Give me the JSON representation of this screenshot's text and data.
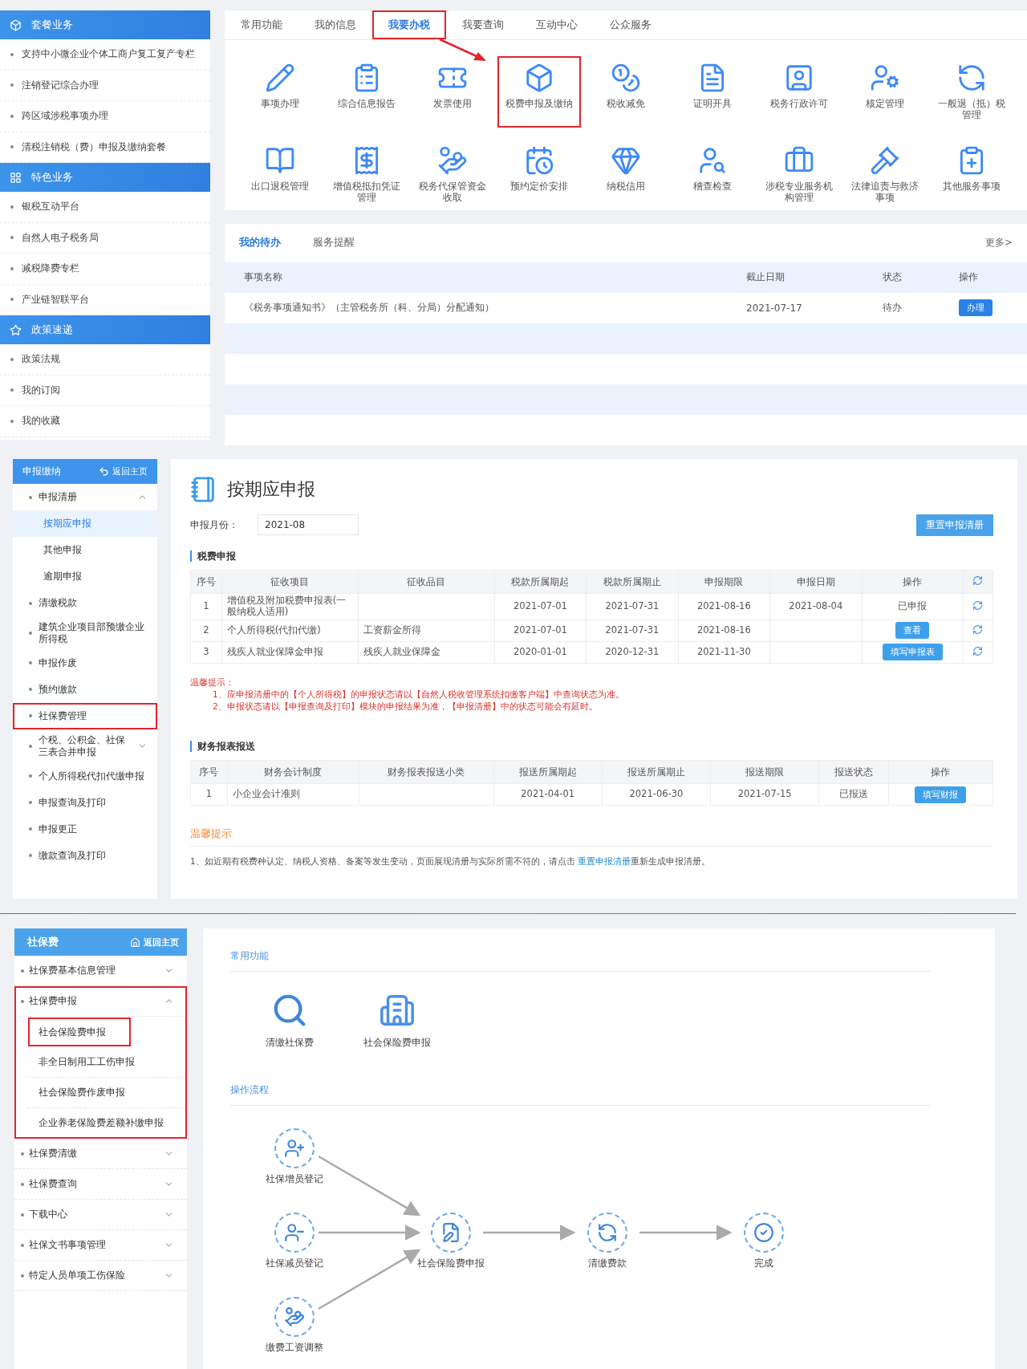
{
  "home": {
    "sidebar": [
      {
        "title": "套餐业务",
        "items": [
          {
            "label": "支持中小微企业个体工商户复工复产专栏"
          },
          {
            "label": "注销登记综合办理"
          },
          {
            "label": "跨区域涉税事项办理"
          },
          {
            "label": "清税注销税（费）申报及缴纳套餐"
          }
        ]
      },
      {
        "title": "特色业务",
        "items": [
          {
            "label": "银税互动平台"
          },
          {
            "label": "自然人电子税务局"
          },
          {
            "label": "减税降费专栏"
          },
          {
            "label": "产业链智联平台"
          }
        ]
      },
      {
        "title": "政策速递",
        "items": [
          {
            "label": "政策法规"
          },
          {
            "label": "我的订阅"
          },
          {
            "label": "我的收藏"
          }
        ]
      }
    ],
    "tabs": [
      {
        "label": "常用功能",
        "selected": false,
        "highlighted": false
      },
      {
        "label": "我的信息",
        "selected": false,
        "highlighted": false
      },
      {
        "label": "我要办税",
        "selected": true,
        "highlighted": true
      },
      {
        "label": "我要查询",
        "selected": false,
        "highlighted": false
      },
      {
        "label": "互动中心",
        "selected": false,
        "highlighted": false
      },
      {
        "label": "公众服务",
        "selected": false,
        "highlighted": false
      }
    ],
    "services": [
      {
        "label": "事项办理",
        "highlighted": false
      },
      {
        "label": "综合信息报告",
        "highlighted": false
      },
      {
        "label": "发票使用",
        "highlighted": false
      },
      {
        "label": "税费申报及缴纳",
        "highlighted": true
      },
      {
        "label": "税收减免",
        "highlighted": false
      },
      {
        "label": "证明开具",
        "highlighted": false
      },
      {
        "label": "税务行政许可",
        "highlighted": false
      },
      {
        "label": "核定管理",
        "highlighted": false
      },
      {
        "label": "一般退（抵）税管理",
        "highlighted": false
      },
      {
        "label": "出口退税管理",
        "highlighted": false
      },
      {
        "label": "增值税抵扣凭证管理",
        "highlighted": false
      },
      {
        "label": "税务代保管资金收取",
        "highlighted": false
      },
      {
        "label": "预约定价安排",
        "highlighted": false
      },
      {
        "label": "纳税信用",
        "highlighted": false
      },
      {
        "label": "稽查检查",
        "highlighted": false
      },
      {
        "label": "涉税专业服务机构管理",
        "highlighted": false
      },
      {
        "label": "法律追责与救济事项",
        "highlighted": false
      },
      {
        "label": "其他服务事项",
        "highlighted": false
      }
    ],
    "todo": {
      "tabs": [
        {
          "label": "我的待办",
          "selected": true
        },
        {
          "label": "服务提醒",
          "selected": false
        }
      ],
      "more": "更多>",
      "columns": [
        "事项名称",
        "截止日期",
        "状态",
        "操作"
      ],
      "rows": [
        {
          "name": "《税务事项通知书》（主管税务所（科、分局）分配通知）",
          "deadline": "2021-07-17",
          "status": "待办",
          "action": "办理"
        }
      ]
    }
  },
  "declaration": {
    "sidebar": {
      "title": "申报缴纳",
      "back": "返回主页",
      "items": [
        {
          "label": "申报清册",
          "expanded": true,
          "highlighted": false,
          "children": [
            {
              "label": "按期应申报",
              "selected": true
            },
            {
              "label": "其他申报",
              "selected": false
            },
            {
              "label": "逾期申报",
              "selected": false
            }
          ]
        },
        {
          "label": "清缴税款",
          "highlighted": false
        },
        {
          "label": "建筑企业项目部预缴企业所得税",
          "highlighted": false
        },
        {
          "label": "申报作废",
          "highlighted": false
        },
        {
          "label": "预约缴款",
          "highlighted": false
        },
        {
          "label": "社保费管理",
          "highlighted": true
        },
        {
          "label": "个税、公积金、社保三表合并申报",
          "expanded": false,
          "highlighted": false
        },
        {
          "label": "个人所得税代扣代缴申报",
          "highlighted": false
        },
        {
          "label": "申报查询及打印",
          "highlighted": false
        },
        {
          "label": "申报更正",
          "highlighted": false
        },
        {
          "label": "缴款查询及打印",
          "highlighted": false
        }
      ]
    },
    "title": "按期应申报",
    "month": {
      "label": "申报月份：",
      "value": "2021-08"
    },
    "reset_button": "重置申报清册",
    "tax_section": {
      "title": "税费申报",
      "columns": [
        "序号",
        "征收项目",
        "征收品目",
        "税款所属期起",
        "税款所属期止",
        "申报期限",
        "申报日期",
        "操作"
      ],
      "rows": [
        {
          "no": "1",
          "item": "增值税及附加税费申报表(一般纳税人适用)",
          "start": "2021-07-01",
          "end": "2021-07-31",
          "deadline": "2021-08-16",
          "date": "2021-08-04",
          "action": {
            "kind": "text",
            "label": "已申报"
          }
        },
        {
          "no": "2",
          "item": "个人所得税(代扣代缴)",
          "subitem": "工资薪金所得",
          "start": "2021-07-01",
          "end": "2021-07-31",
          "deadline": "2021-08-16",
          "action": {
            "kind": "button",
            "label": "查看"
          }
        },
        {
          "no": "3",
          "item": "残疾人就业保障金申报",
          "subitem": "残疾人就业保障金",
          "start": "2020-01-01",
          "end": "2020-12-31",
          "deadline": "2021-11-30",
          "action": {
            "kind": "button",
            "label": "填写申报表"
          }
        }
      ]
    },
    "notes": {
      "title": "温馨提示：",
      "lines": [
        "1、应申报清册中的【个人所得税】的申报状态请以【自然人税收管理系统扣缴客户端】中查询状态为准。",
        "2、申报状态请以【申报查询及打印】模块的申报结果为准，【申报清册】中的状态可能会有延时。"
      ]
    },
    "finance_section": {
      "title": "财务报表报送",
      "columns": [
        "序号",
        "财务会计制度",
        "财务报表报送小类",
        "报送所属期起",
        "报送所属期止",
        "报送期限",
        "报送状态",
        "操作"
      ],
      "rows": [
        {
          "no": "1",
          "system": "小企业会计准则",
          "start": "2021-04-01",
          "end": "2021-06-30",
          "deadline": "2021-07-15",
          "status": "已报送",
          "action": {
            "kind": "button",
            "label": "填写财报"
          }
        }
      ]
    },
    "tip": {
      "title": "温馨提示",
      "text": "1、如近期有税费种认定、纳税人资格、备案等发生变动，页面展现清册与实际所需不符的，请点击",
      "link": "重置申报清册",
      "after": "重新生成申报清册。"
    }
  },
  "social": {
    "sidebar": {
      "title": "社保费",
      "back": "返回主页",
      "items": [
        {
          "label": "社保费基本信息管理",
          "expanded": false,
          "highlighted": false
        },
        {
          "label": "社保费申报",
          "expanded": true,
          "highlighted": true,
          "children": [
            {
              "label": "社会保险费申报",
              "highlighted": true
            },
            {
              "label": "非全日制用工工伤申报",
              "highlighted": false
            },
            {
              "label": "社会保险费作废申报",
              "highlighted": false
            },
            {
              "label": "企业养老保险费差额补缴申报",
              "highlighted": false
            }
          ]
        },
        {
          "label": "社保费清缴",
          "expanded": false,
          "highlighted": false
        },
        {
          "label": "社保费查询",
          "expanded": false,
          "highlighted": false
        },
        {
          "label": "下载中心",
          "expanded": false,
          "highlighted": false
        },
        {
          "label": "社保文书事项管理",
          "expanded": false,
          "highlighted": false
        },
        {
          "label": "特定人员单项工伤保险",
          "expanded": false,
          "highlighted": false
        }
      ]
    },
    "common_title": "常用功能",
    "shortcuts": [
      "清缴社保费",
      "社会保险费申报"
    ],
    "flow_title": "操作流程",
    "flow": {
      "sources": [
        "社保增员登记",
        "社保减员登记",
        "缴费工资调整"
      ],
      "steps": [
        "社会保险费申报",
        "清缴费款",
        "完成"
      ]
    }
  }
}
